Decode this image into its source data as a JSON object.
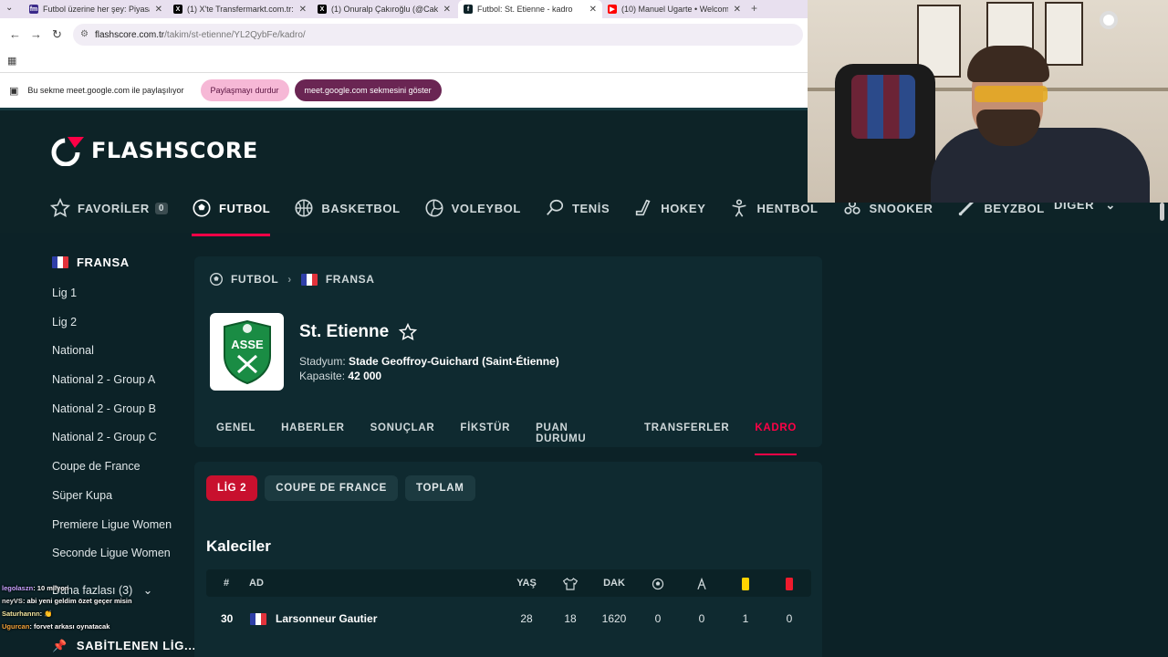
{
  "browser": {
    "tabs": [
      {
        "title": "Futbol üzerine her şey: Piyasa D",
        "favicon_color": "#3b2a8a",
        "favicon_glyph": "fm"
      },
      {
        "title": "(1) X'te Transfermarkt.com.tr: \"I",
        "favicon_color": "#000000",
        "favicon_glyph": "X"
      },
      {
        "title": "(1) Onuralp Çakıroğlu (@Cakro",
        "favicon_color": "#000000",
        "favicon_glyph": "X"
      },
      {
        "title": "Futbol: St. Etienne - kadro",
        "favicon_color": "#0c2227",
        "favicon_glyph": "f"
      },
      {
        "title": "(10) Manuel Ugarte • Welcome",
        "favicon_color": "#ff0000",
        "favicon_glyph": "▶"
      }
    ],
    "url_host": "flashscore.com.tr",
    "url_path": "/takim/st-etienne/YL2QybFe/kadro/",
    "share_text": "Bu sekme meet.google.com ile paylaşılıyor",
    "stop_sharing": "Paylaşmayı durdur",
    "show_tab": "meet.google.com sekmesini göster"
  },
  "site": {
    "logo_text": "FLASHSCORE",
    "nav": [
      {
        "label": "FAVORİLER",
        "icon": "star-icon",
        "badge": "0"
      },
      {
        "label": "FUTBOL",
        "icon": "soccer-ball-icon",
        "active": true
      },
      {
        "label": "BASKETBOL",
        "icon": "basketball-icon"
      },
      {
        "label": "VOLEYBOL",
        "icon": "volleyball-icon"
      },
      {
        "label": "TENİS",
        "icon": "tennis-icon"
      },
      {
        "label": "HOKEY",
        "icon": "hockey-icon"
      },
      {
        "label": "HENTBOL",
        "icon": "handball-icon"
      },
      {
        "label": "SNOOKER",
        "icon": "snooker-icon"
      },
      {
        "label": "BEYZBOL",
        "icon": "baseball-icon"
      }
    ],
    "nav_more": "DİĞER",
    "accent": "#ff0046"
  },
  "sidebar": {
    "country": "FRANSA",
    "items": [
      "Lig 1",
      "Lig 2",
      "National",
      "National 2 - Group A",
      "National 2 - Group B",
      "National 2 - Group C",
      "Coupe de France",
      "Süper Kupa",
      "Premiere Ligue Women",
      "Seconde Ligue Women"
    ],
    "more": "Daha fazlası (3)",
    "pinned": "SABİTLENEN LİG..."
  },
  "team": {
    "crumbs": [
      "FUTBOL",
      "FRANSA"
    ],
    "name": "St. Etienne",
    "stadium_label": "Stadyum:",
    "stadium": "Stade Geoffroy-Guichard (Saint-Étienne)",
    "capacity_label": "Kapasite:",
    "capacity": "42 000",
    "crest_text": "ASSE",
    "tabs": [
      "GENEL",
      "HABERLER",
      "SONUÇLAR",
      "FİKSTÜR",
      "PUAN DURUMU",
      "TRANSFERLER",
      "KADRO"
    ]
  },
  "squad": {
    "filters": [
      "LİG 2",
      "COUPE DE FRANCE",
      "TOPLAM"
    ],
    "section": "Kaleciler",
    "headers": {
      "num": "#",
      "name": "AD",
      "age": "YAŞ",
      "dak": "DAK"
    },
    "rows": [
      {
        "num": "30",
        "name": "Larsonneur Gautier",
        "age": "28",
        "matches": "18",
        "minutes": "1620",
        "goals": "0",
        "assists": "0",
        "yellow": "1",
        "red": "0"
      }
    ]
  },
  "chat": [
    {
      "user": "legolaszn",
      "msg": ": 10 milyon"
    },
    {
      "user": "neyVS",
      "msg": ": abi yeni geldim özet geçer misin"
    },
    {
      "user": "Saturhannn",
      "msg": ": 👏"
    },
    {
      "user": "Ugurcan",
      "msg": ": forvet arkası oynatacak"
    }
  ]
}
